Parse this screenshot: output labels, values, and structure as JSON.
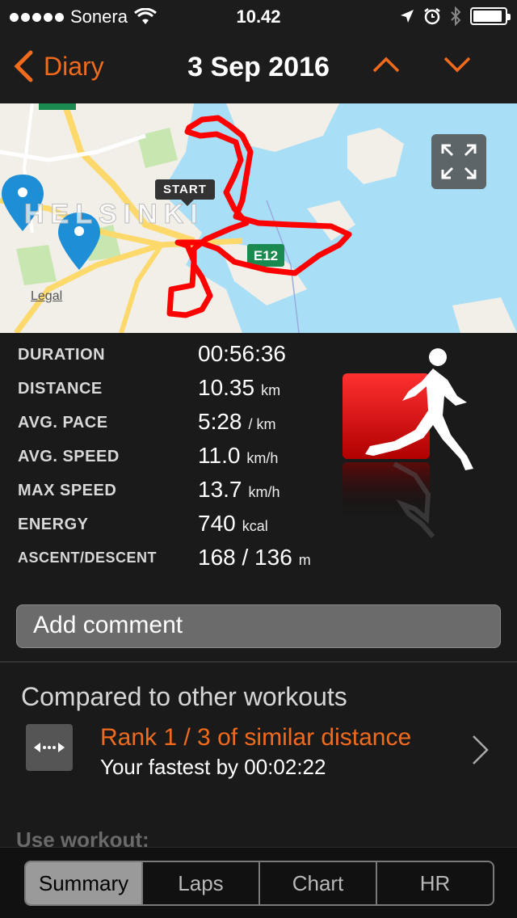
{
  "status_bar": {
    "carrier": "Sonera",
    "time": "10.42"
  },
  "nav": {
    "back_label": "Diary",
    "title": "3 Sep 2016"
  },
  "map": {
    "start_label": "START",
    "legal_label": "Legal",
    "city_label": "HELSINKI",
    "road_label": "E12"
  },
  "stats": [
    {
      "label": "DURATION",
      "value": "00:56:36",
      "unit": ""
    },
    {
      "label": "DISTANCE",
      "value": "10.35",
      "unit": "km"
    },
    {
      "label": "AVG. PACE",
      "value": "5:28",
      "unit": "/ km"
    },
    {
      "label": "AVG. SPEED",
      "value": "11.0",
      "unit": "km/h"
    },
    {
      "label": "MAX SPEED",
      "value": "13.7",
      "unit": "km/h"
    },
    {
      "label": "ENERGY",
      "value": "740",
      "unit": "kcal"
    },
    {
      "label": "ASCENT/DESCENT",
      "value": "168 / 136",
      "unit": "m"
    }
  ],
  "comment": {
    "placeholder": "Add comment"
  },
  "compare": {
    "heading": "Compared to other workouts",
    "rank": "Rank 1 / 3 of similar distance",
    "fastest": "Your fastest by 00:02:22",
    "use_workout": "Use workout:"
  },
  "tabs": [
    {
      "label": "Summary",
      "active": true
    },
    {
      "label": "Laps",
      "active": false
    },
    {
      "label": "Chart",
      "active": false
    },
    {
      "label": "HR",
      "active": false
    }
  ],
  "colors": {
    "accent": "#f26b1d",
    "route": "#ff0000",
    "water": "#a9def7",
    "land": "#f2efe9",
    "road": "#fcd96a",
    "park": "#c8e6b0"
  }
}
